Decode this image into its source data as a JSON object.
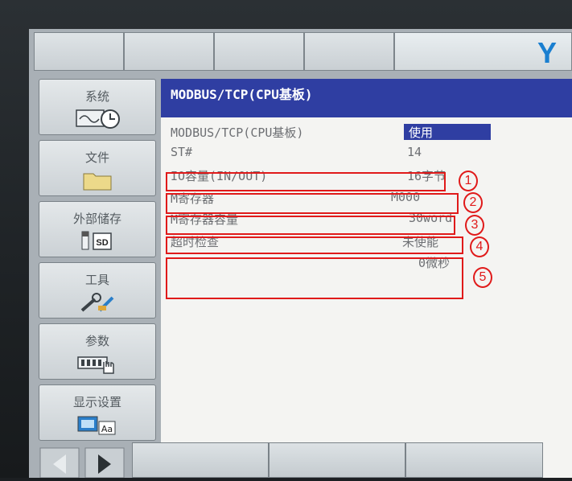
{
  "header": {
    "brand_letter": "Y"
  },
  "sidebar": {
    "items": [
      {
        "label": "系统",
        "icon": "system-clock-icon"
      },
      {
        "label": "文件",
        "icon": "folder-icon"
      },
      {
        "label": "外部储存",
        "icon": "sd-card-icon"
      },
      {
        "label": "工具",
        "icon": "tools-icon"
      },
      {
        "label": "参数",
        "icon": "parameter-hand-icon"
      },
      {
        "label": "显示设置",
        "icon": "display-settings-icon"
      }
    ]
  },
  "panel": {
    "title": "MODBUS/TCP(CPU基板)",
    "header_label": "MODBUS/TCP(CPU基板)",
    "header_value": "使用",
    "rows": [
      {
        "label": "ST#",
        "value": "14"
      },
      {
        "label": "IO容量(IN/OUT)",
        "value": "16字节"
      },
      {
        "label": "M寄存器",
        "value": "M000"
      },
      {
        "label": "M寄存器容量",
        "value": "30word"
      },
      {
        "label": "超时检查",
        "value": "未使能",
        "value2": "0微秒"
      }
    ]
  },
  "annotations": {
    "numbers": [
      "1",
      "2",
      "3",
      "4",
      "5"
    ],
    "color": "#e01a1a"
  },
  "colors": {
    "title_bar": "#2f3ea2",
    "brand": "#1a7fd0"
  }
}
